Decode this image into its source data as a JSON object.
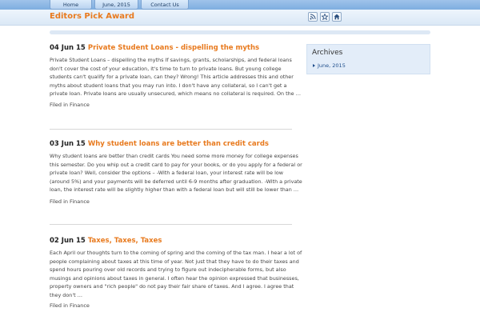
{
  "nav": {
    "tabs": [
      {
        "label": "Home"
      },
      {
        "label": "June, 2015"
      },
      {
        "label": "Contact Us"
      }
    ]
  },
  "header": {
    "site_title": "Editors Pick Award",
    "icons": [
      "rss-icon",
      "star-icon",
      "home-icon"
    ]
  },
  "colors": {
    "accent": "#e87a1e",
    "link": "#1f4e8c",
    "nav_bar": "#7eaee0",
    "sidebar_bg": "#e3edf9"
  },
  "posts": [
    {
      "date": "04 Jun 15",
      "title": "Private Student Loans - dispelling the myths",
      "excerpt": "Private Student Loans – dispelling the myths If savings, grants, scholarships, and federal loans don't cover the cost of your education, it's time to turn to private loans. But young college students can't qualify for a private loan, can they? Wrong! This article addresses this and other myths about student loans that you may run into. I don't have any collateral, so I can't get a private loan. Private loans are usually unsecured, which means no collateral is required. On the …",
      "filed": "Filed in Finance"
    },
    {
      "date": "03 Jun 15",
      "title": "Why student loans are better than credit cards",
      "excerpt": "Why student loans are better than credit cards You need some more money for college expenses this semester. Do you whip out a credit card to pay for your books, or do you apply for a federal or private loan? Well, consider the options – -With a federal loan, your interest rate will be low (around 5%) and your payments will be deferred until 6-9 months after graduation. -With a private loan, the interest rate will be slightly higher than with a federal loan but will still be lower than …",
      "filed": "Filed in Finance"
    },
    {
      "date": "02 Jun 15",
      "title": "Taxes, Taxes, Taxes",
      "excerpt": "Each April our thoughts turn to the coming of spring and the coming of the tax man. I hear a lot of people complaining about taxes at this time of year. Not just that they have to do their taxes and spend hours pouring over old records and trying to figure out indecipherable forms, but also musings and opinions about taxes in general. I often hear the opinion expressed that businesses, property owners and \"rich people\" do not pay their fair share of taxes. And I agree. I agree that they don't …",
      "filed": "Filed in Finance"
    }
  ],
  "sidebar": {
    "title": "Archives",
    "items": [
      {
        "label": "June, 2015"
      }
    ]
  }
}
